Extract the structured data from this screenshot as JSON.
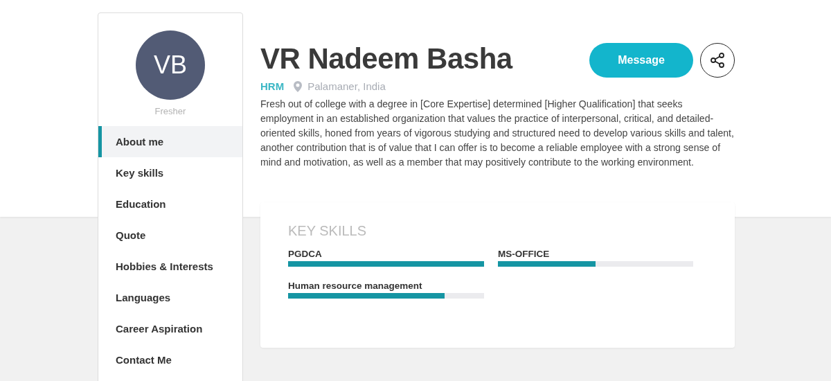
{
  "profile": {
    "initials": "VB",
    "status": "Fresher",
    "name": "VR Nadeem Basha",
    "role": "HRM",
    "location": "Palamaner, India",
    "bio": "Fresh out of college with a degree in [Core Expertise] determined [Higher Qualification] that seeks employment in an established organization that values the practice of interpersonal, critical, and detailed-oriented skills, honed from years of vigorous studying and structured need to develop various skills and talent, another contribution that is of value that I can offer is to become a reliable employee with a strong sense of mind and motivation, as well as a member that may positively contribute to the working environment."
  },
  "actions": {
    "message": "Message"
  },
  "sidebar": {
    "items": [
      {
        "label": "About me",
        "selected": true
      },
      {
        "label": "Key skills",
        "selected": false
      },
      {
        "label": "Education",
        "selected": false
      },
      {
        "label": "Quote",
        "selected": false
      },
      {
        "label": "Hobbies & Interests",
        "selected": false
      },
      {
        "label": "Languages",
        "selected": false
      },
      {
        "label": "Career Aspiration",
        "selected": false
      },
      {
        "label": "Contact Me",
        "selected": false
      }
    ]
  },
  "key_skills": {
    "title": "KEY SKILLS",
    "skills": [
      {
        "name": "PGDCA",
        "level": 1.0
      },
      {
        "name": "MS-OFFICE",
        "level": 0.5
      },
      {
        "name": "Human resource management",
        "level": 0.8
      }
    ]
  }
}
